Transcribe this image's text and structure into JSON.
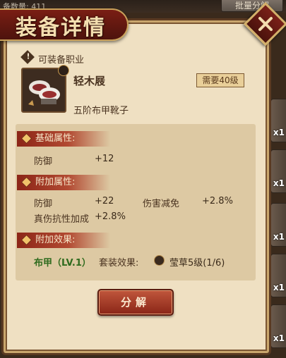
{
  "background": {
    "count_label": "备数量: 411",
    "batch_button": "批量分解",
    "slot_count_label": "x1"
  },
  "dialog": {
    "title": "装备详情",
    "close_icon": "close-icon",
    "requirement_label": "可装备职业",
    "item": {
      "name": "轻木屐",
      "level_badge": "需要40级",
      "type": "五阶布甲靴子"
    },
    "sections": {
      "base": {
        "title": "基础属性:",
        "stats": [
          {
            "label": "防御",
            "value": "+12"
          }
        ]
      },
      "extra": {
        "title": "附加属性:",
        "stats": [
          {
            "label": "防御",
            "value": "+22"
          },
          {
            "label": "伤害减免",
            "value": "+2.8%"
          },
          {
            "label": "真伤抗性加成",
            "value": "+2.8%"
          }
        ]
      },
      "effects": {
        "title": "附加效果:",
        "armor_type": "布甲（LV.1）",
        "set_label": "套装效果:",
        "set_value": "莹草5级(1/6)"
      }
    },
    "decompose_button": "分解"
  },
  "colors": {
    "panel": "#efe0c2",
    "banner": "#7a1e14",
    "section_head": "#8c2517",
    "armor_type": "#2f6b1e"
  }
}
